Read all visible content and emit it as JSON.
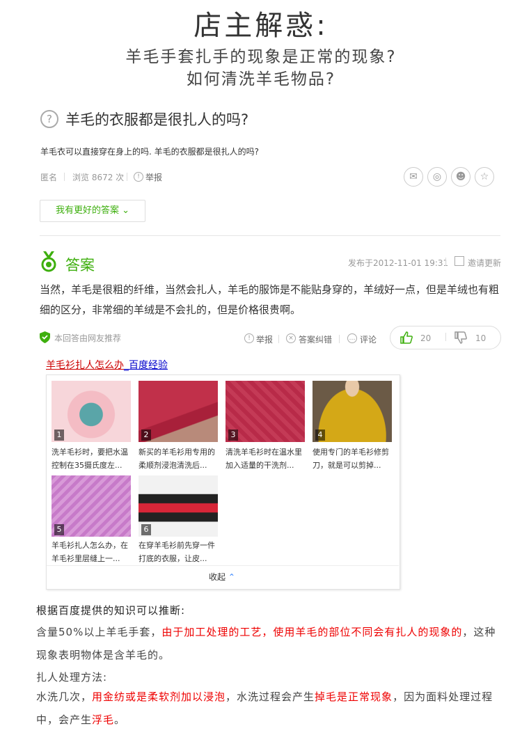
{
  "header": {
    "title": "店主解惑:",
    "line1": "羊毛手套扎手的现象是正常的现象?",
    "line2": "如何清洗羊毛物品?"
  },
  "question": {
    "title": "羊毛的衣服都是很扎人的吗?",
    "description": "羊毛衣可以直接穿在身上的吗. 羊毛的衣服都是很扎人的吗?",
    "author": "匿名",
    "views": "浏览 8672 次",
    "report": "举报",
    "better_answer": "我有更好的答案"
  },
  "answer": {
    "heading": "答案",
    "date": "发布于2012-11-01 19:31",
    "update": "邀请更新",
    "text": "当然，羊毛是很粗的纤维，当然会扎人，羊毛的服饰是不能贴身穿的，羊绒好一点，但是羊绒也有粗细的区分，非常细的羊绒是不会扎的，但是价格很贵啊。",
    "recommend": "本回答由网友推荐",
    "report": "举报",
    "correct": "答案纠错",
    "comment": "评论",
    "up": "20",
    "down": "10"
  },
  "exp": {
    "link_main": "羊毛衫扎人怎么办",
    "link_source": "_百度经验",
    "items": [
      {
        "num": "1",
        "cap1": "洗羊毛衫时，要把水温",
        "cap2": "控制在35摄氏度左..."
      },
      {
        "num": "2",
        "cap1": "新买的羊毛衫用专用的",
        "cap2": "柔顺剂浸泡清洗后..."
      },
      {
        "num": "3",
        "cap1": "清洗羊毛衫时在温水里",
        "cap2": "加入适量的干洗剂..."
      },
      {
        "num": "4",
        "cap1": "使用专门的羊毛衫修剪",
        "cap2": "刀，就是可以剪掉..."
      },
      {
        "num": "5",
        "cap1": "羊毛衫扎人怎么办，在",
        "cap2": "羊毛衫里层缝上一..."
      },
      {
        "num": "6",
        "cap1": "在穿羊毛衫前先穿一件",
        "cap2": "打底的衣服，让皮..."
      }
    ],
    "collapse": "收起"
  },
  "conclusion": {
    "heading": "根据百度提供的知识可以推断:",
    "p1_a": "含量50%以上羊毛手套，",
    "p1_b": "由于加工处理的工艺，使用羊毛的部位不同会有扎人的现象的",
    "p1_c": "，这种现象表明物体是含羊毛的。",
    "method_heading": "扎人处理方法:",
    "p2_a": "水洗几次，",
    "p2_b": "用金纺或是柔软剂加以浸泡",
    "p2_c": "，水洗过程会产生",
    "p2_d": "掉毛是正常现象",
    "p2_e": "，因为面料处理过程中，会产生",
    "p2_f": "浮毛",
    "p2_g": "。"
  },
  "colors": {
    "accent_green": "#3eaf0e",
    "highlight_red": "#e00000",
    "link_blue": "#0000cc"
  }
}
